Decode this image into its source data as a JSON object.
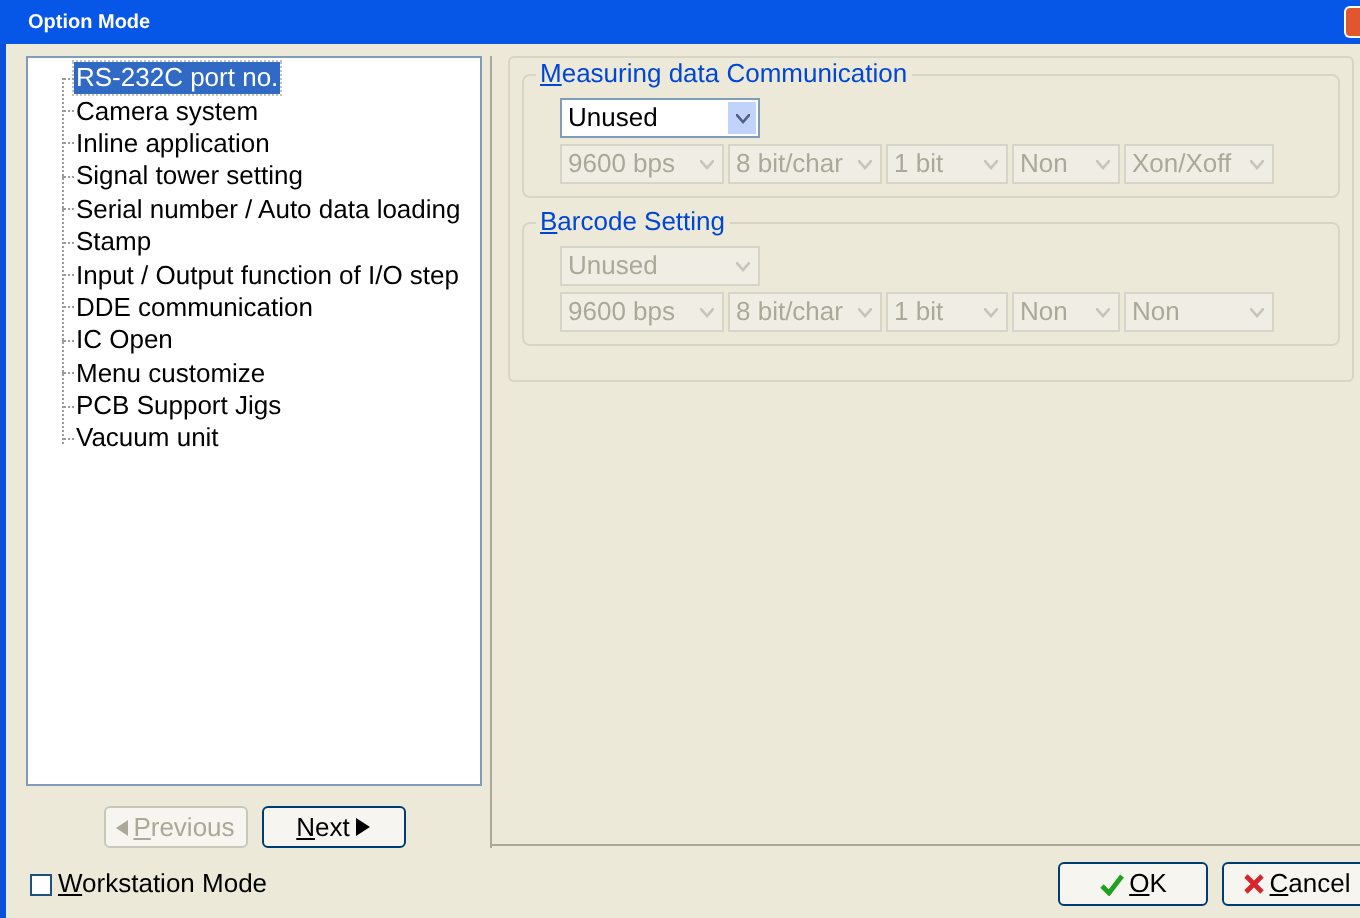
{
  "window": {
    "title": "Option Mode"
  },
  "tree": {
    "items": [
      {
        "label": "RS-232C port no.",
        "selected": true
      },
      {
        "label": "Camera system",
        "selected": false
      },
      {
        "label": "Inline application",
        "selected": false
      },
      {
        "label": "Signal tower setting",
        "selected": false
      },
      {
        "label": "Serial number / Auto data loading",
        "selected": false
      },
      {
        "label": "Stamp",
        "selected": false
      },
      {
        "label": "Input / Output function of I/O step",
        "selected": false
      },
      {
        "label": "DDE communication",
        "selected": false
      },
      {
        "label": "IC Open",
        "selected": false
      },
      {
        "label": "Menu customize",
        "selected": false
      },
      {
        "label": "PCB Support Jigs",
        "selected": false
      },
      {
        "label": "Vacuum unit",
        "selected": false
      }
    ]
  },
  "nav_buttons": [
    {
      "kind": "previous",
      "label": "Previous",
      "disabled": true
    },
    {
      "kind": "next",
      "label": "Next",
      "disabled": false
    }
  ],
  "groups": [
    {
      "title": "Measuring data Communication",
      "port": {
        "value": "Unused",
        "disabled": false
      },
      "settings": [
        {
          "value": "9600 bps",
          "disabled": true
        },
        {
          "value": "8 bit/char",
          "disabled": true
        },
        {
          "value": "1 bit",
          "disabled": true
        },
        {
          "value": "Non",
          "disabled": true
        },
        {
          "value": "Xon/Xoff",
          "disabled": true
        }
      ]
    },
    {
      "title": "Barcode Setting",
      "port": {
        "value": "Unused",
        "disabled": true
      },
      "settings": [
        {
          "value": "9600 bps",
          "disabled": true
        },
        {
          "value": "8 bit/char",
          "disabled": true
        },
        {
          "value": "1 bit",
          "disabled": true
        },
        {
          "value": "Non",
          "disabled": true
        },
        {
          "value": "Non",
          "disabled": true
        }
      ]
    }
  ],
  "workstation_mode": {
    "label": "Workstation Mode",
    "checked": false
  },
  "dialog_buttons": [
    {
      "kind": "ok",
      "label": "OK"
    },
    {
      "kind": "cancel",
      "label": "Cancel"
    }
  ]
}
